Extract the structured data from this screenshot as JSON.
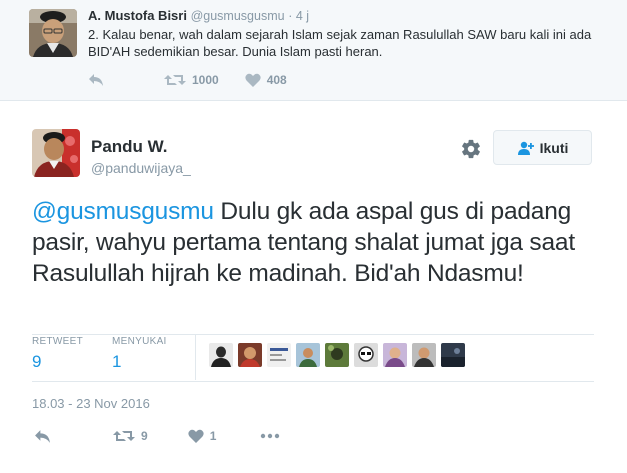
{
  "parent_tweet": {
    "name": "A. Mustofa Bisri",
    "handle": "@gusmusgusmu",
    "time": "· 4 j",
    "text": "2. Kalau benar, wah dalam sejarah Islam sejak zaman Rasulullah SAW baru kali ini ada BID'AH sedemikian besar. Dunia Islam pasti heran.",
    "retweet_count": "1000",
    "like_count": "408"
  },
  "tweet": {
    "name": "Pandu W.",
    "handle": "@panduwijaya_",
    "follow_label": "Ikuti",
    "mention": "@gusmusgusmu",
    "text": " Dulu gk ada aspal gus di padang pasir, wahyu pertama tentang shalat jumat jga saat Rasulullah hijrah ke madinah. Bid'ah Ndasmu!",
    "stats": {
      "retweet_label": "RETWEET",
      "retweet_value": "9",
      "like_label": "MENYUKAI",
      "like_value": "1"
    },
    "timestamp": "18.03 - 23 Nov 2016",
    "action_retweet_count": "9",
    "action_like_count": "1"
  },
  "colors": {
    "link": "#1b95e0",
    "muted": "#8899a6",
    "text": "#292f33",
    "action_icon": "#8899a6"
  },
  "icons": {
    "reply": "reply-icon",
    "retweet": "retweet-icon",
    "like": "heart-icon",
    "more": "more-dots-icon",
    "settings": "gear-icon",
    "follow": "add-user-icon"
  }
}
